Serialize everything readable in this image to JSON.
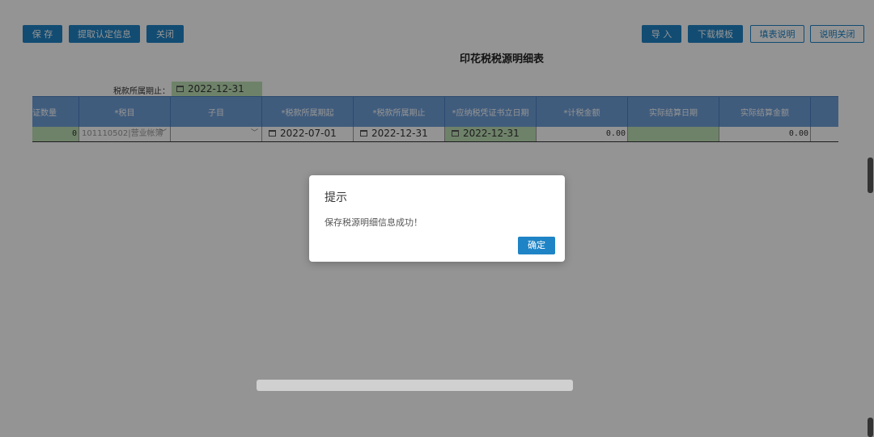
{
  "toolbar": {
    "save": "保 存",
    "fetch": "提取认定信息",
    "close": "关闭",
    "import": "导 入",
    "download": "下载模板",
    "fill_help": "填表说明",
    "close_help": "说明关闭"
  },
  "page_title": "印花税税源明细表",
  "period": {
    "label": "税款所属期止：",
    "value": "2022-12-31"
  },
  "table": {
    "headers": [
      "证数量",
      "*税目",
      "子目",
      "*税款所属期起",
      "*税款所属期止",
      "*应纳税凭证书立日期",
      "*计税金额",
      "实际结算日期",
      "实际结算金额",
      ""
    ],
    "row": {
      "count": "0",
      "item": "101110502|营业帐簿",
      "subitem": "",
      "start": "2022-07-01",
      "end": "2022-12-31",
      "sign_date": "2022-12-31",
      "amount": "0.00",
      "settle_date": "",
      "settle_amount": "0.00"
    }
  },
  "dialog": {
    "title": "提示",
    "message": "保存税源明细信息成功！",
    "ok": "确定"
  }
}
